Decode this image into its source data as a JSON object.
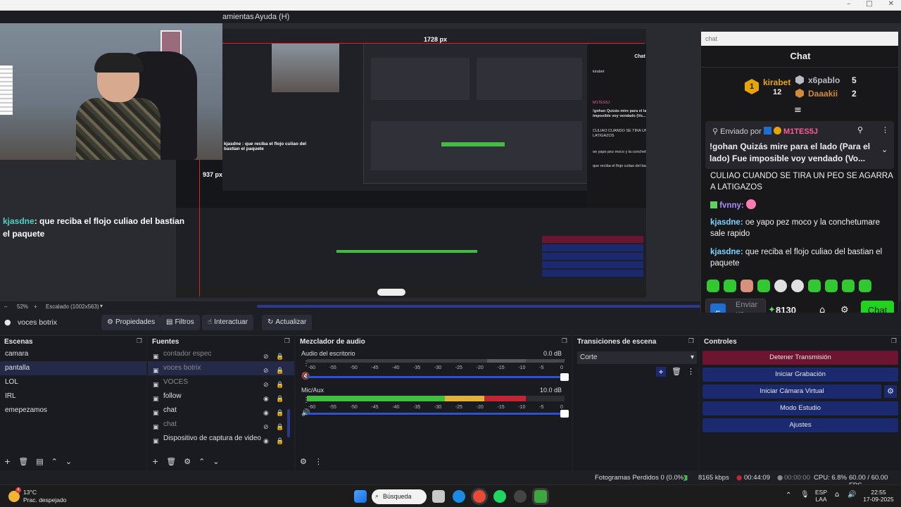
{
  "menu": {
    "items": [
      "amientas",
      "Ayuda (H)"
    ]
  },
  "window_controls": [
    "–",
    "□",
    "✕"
  ],
  "preview": {
    "width_label": "1728 px",
    "height_label": "937 px",
    "overlay_message": {
      "user": "kjasdne",
      "text": ": que reciba el flojo culiao del bastian el paquete"
    },
    "mini_message": "kjasdne : que reciba el flojo culiao del bastian el paquete",
    "mini_menu": "amientas   Ayuda (H)"
  },
  "chat": {
    "url": "chat",
    "title": "Chat",
    "leaderboard": [
      {
        "rank": "1",
        "name": "kirabet",
        "score": "12",
        "color": "#e8a400"
      },
      {
        "rank": "2",
        "name": "x6pablo",
        "score": "5",
        "color": "#b8bcc6"
      },
      {
        "rank": "3",
        "name": "Daaakii",
        "score": "2",
        "color": "#d08a3a"
      }
    ],
    "pinned": {
      "header": "Enviado por",
      "user": "M1TES5J",
      "text": "!gohan Quizás mire para el lado (Para el lado) Fue imposible voy vendado (Vo..."
    },
    "messages": [
      {
        "user": "",
        "text": "CULIAO CUANDO SE TIRA UN PEO SE AGARRA A LATIGAZOS"
      },
      {
        "user": "fvnny:",
        "text": ""
      },
      {
        "user": "kjasdne:",
        "text": "oe yapo pez moco y la conchetumare sale rapido"
      },
      {
        "user": "kjasdne:",
        "text": "que reciba el flojo culiao del bastian el paquete"
      }
    ],
    "input_placeholder": "Enviar un mensaje",
    "points": "8130",
    "send_label": "Chat"
  },
  "preview_status": {
    "zoom": "52%",
    "scale": "Escalado (1002x563)"
  },
  "source_toolbar": {
    "source_name": "voces botrix",
    "buttons": [
      "Propiedades",
      "Filtros",
      "Interactuar",
      "Actualizar"
    ]
  },
  "scenes": {
    "title": "Escenas",
    "items": [
      "camara",
      "pantalla",
      "LOL",
      "IRL",
      "emepezamos"
    ],
    "selected": 1
  },
  "sources": {
    "title": "Fuentes",
    "items": [
      {
        "name": "contador espec",
        "visible": false,
        "dim": true
      },
      {
        "name": "voces botrix",
        "visible": false,
        "dim": true,
        "selected": true
      },
      {
        "name": "VOCES",
        "visible": false,
        "dim": true
      },
      {
        "name": "follow",
        "visible": true,
        "dim": false
      },
      {
        "name": "chat",
        "visible": true,
        "dim": false
      },
      {
        "name": "chat",
        "visible": false,
        "dim": true
      },
      {
        "name": "Dispositivo de captura de video",
        "visible": true,
        "dim": false
      }
    ]
  },
  "mixer": {
    "title": "Mezclador de audio",
    "channels": [
      {
        "name": "Audio del escritorio",
        "db": "0.0 dB",
        "level": 0.0,
        "muted": true
      },
      {
        "name": "Mic/Aux",
        "db": "10.0 dB",
        "level": 0.85,
        "muted": false
      }
    ],
    "ticks": [
      "-60",
      "-55",
      "-50",
      "-45",
      "-40",
      "-35",
      "-30",
      "-25",
      "-20",
      "-15",
      "-10",
      "-5",
      "0"
    ]
  },
  "transitions": {
    "title": "Transiciones de escena",
    "selected": "Corte"
  },
  "controls": {
    "title": "Controles",
    "buttons": [
      "Detener Transmisión",
      "Iniciar Grabación",
      "Iniciar Cámara Virtual",
      "Modo Estudio",
      "Ajustes"
    ]
  },
  "obs_status": {
    "dropped": "Fotogramas Perdidos 0 (0.0%)",
    "bitrate": "8165 kbps",
    "live_time": "00:44:09",
    "rec_time": "00:00:00",
    "cpu": "CPU: 6.8%",
    "fps": "60.00 / 60.00 FPS"
  },
  "taskbar": {
    "weather_temp": "13°C",
    "weather_desc": "Prac. despejado",
    "weather_badge": "4",
    "search": "Búsqueda",
    "lang_top": "ESP",
    "lang_bottom": "LAA",
    "time": "22:55",
    "date": "17-09-2025"
  }
}
